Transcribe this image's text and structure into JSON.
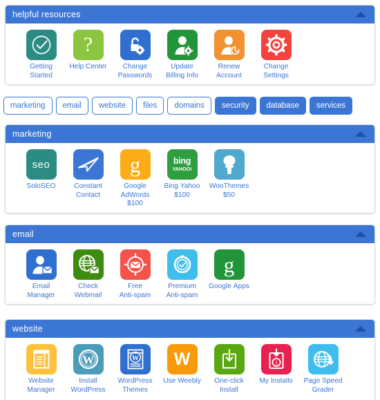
{
  "panels": [
    {
      "id": "helpful-resources",
      "title": "helpful resources",
      "collapse_icon": "chevron-up-icon",
      "items": [
        {
          "label": "Getting\nStarted",
          "icon": "check-circle-icon",
          "color": "#2c8c83"
        },
        {
          "label": "Help Center",
          "icon": "question-mark-icon",
          "color": "#8cc63e"
        },
        {
          "label": "Change\nPasswords",
          "icon": "unlock-gear-icon",
          "color": "#2f6fd0"
        },
        {
          "label": "Update\nBilling Info",
          "icon": "user-gear-icon",
          "color": "#22953a"
        },
        {
          "label": "Renew\nAccount",
          "icon": "user-renew-icon",
          "color": "#f2912f"
        },
        {
          "label": "Change\nSettings",
          "icon": "gear-icon",
          "color": "#f2433f"
        }
      ]
    },
    {
      "id": "marketing",
      "title": "marketing",
      "collapse_icon": "chevron-up-icon",
      "items": [
        {
          "label": "SoloSEO",
          "icon": "seo-icon",
          "color": "#2c8c83"
        },
        {
          "label": "Constant\nContact",
          "icon": "paper-plane-icon",
          "color": "#3b76d4"
        },
        {
          "label": "Google\nAdWords\n$100",
          "icon": "google-g-icon",
          "color": "#fbad18"
        },
        {
          "label": "Bing Yahoo\n$100",
          "icon": "bing-yahoo-icon",
          "color": "#2e9e3e"
        },
        {
          "label": "WooThemes\n$50",
          "icon": "woothemes-icon",
          "color": "#4fa8cd"
        }
      ]
    },
    {
      "id": "email",
      "title": "email",
      "collapse_icon": "chevron-up-icon",
      "items": [
        {
          "label": "Email\nManager",
          "icon": "user-envelope-icon",
          "color": "#2f6fd0"
        },
        {
          "label": "Check\nWebmail",
          "icon": "globe-envelope-icon",
          "color": "#3d8c0f"
        },
        {
          "label": "Free\nAnti-spam",
          "icon": "target-mail-icon",
          "color": "#f4524d"
        },
        {
          "label": "Premium\nAnti-spam",
          "icon": "shield-check-icon",
          "color": "#3fbdec"
        },
        {
          "label": "Google Apps",
          "icon": "google-g-icon",
          "color": "#22953a"
        }
      ]
    },
    {
      "id": "website",
      "title": "website",
      "collapse_icon": "chevron-up-icon",
      "items": [
        {
          "label": "Website\nManager",
          "icon": "layout-page-icon",
          "color": "#fcc13f"
        },
        {
          "label": "Install\nWordPress",
          "icon": "wordpress-icon",
          "color": "#4b9cb8"
        },
        {
          "label": "WordPress\nThemes",
          "icon": "wordpress-theme-icon",
          "color": "#2f6fd0"
        },
        {
          "label": "Use Weebly",
          "icon": "weebly-w-icon",
          "color": "#f99a0b"
        },
        {
          "label": "One-click\nInstall",
          "icon": "download-box-icon",
          "color": "#5aa811"
        },
        {
          "label": "My Installs",
          "icon": "install-lock-icon",
          "color": "#e8214f"
        },
        {
          "label": "Page Speed\nGrader",
          "icon": "globe-speed-icon",
          "color": "#3fbdec"
        }
      ]
    }
  ],
  "tabs": [
    {
      "label": "marketing",
      "state": "outline"
    },
    {
      "label": "email",
      "state": "outline"
    },
    {
      "label": "website",
      "state": "outline"
    },
    {
      "label": "files",
      "state": "outline"
    },
    {
      "label": "domains",
      "state": "outline"
    },
    {
      "label": "security",
      "state": "filled"
    },
    {
      "label": "database",
      "state": "filled"
    },
    {
      "label": "services",
      "state": "filled"
    }
  ],
  "colors": {
    "accent_blue": "#3b76d4",
    "header_blue": "#3b76d4",
    "collapse_arrow": "#1b4fa8",
    "label_blue": "#3b76d4",
    "panel_border": "#d8d8d8"
  }
}
